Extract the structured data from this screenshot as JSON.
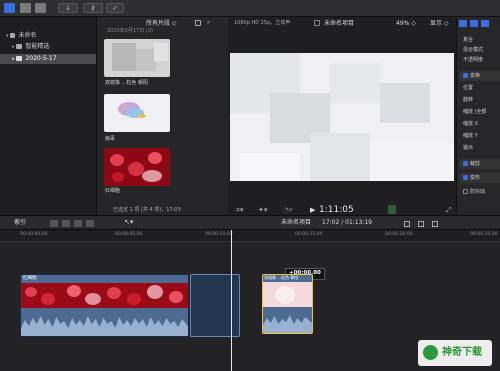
{
  "topbar": {
    "download_icon": "↓",
    "key_icon": "⚷",
    "check_icon": "✓"
  },
  "library": {
    "items": [
      {
        "label": "未命名",
        "selected": false
      },
      {
        "label": "智能精选",
        "selected": false
      },
      {
        "label": "2020-5-17",
        "selected": true
      }
    ]
  },
  "browser": {
    "filter": "所有片段",
    "date_header": "2020年5月17日",
    "date_count": "(3)",
    "clips": [
      {
        "label": "双镜像 ...粒色 朝阳"
      },
      {
        "label": "病毒"
      },
      {
        "label": "红细胞"
      }
    ],
    "status": "已选定 1 项 (共 4 项)，17:03"
  },
  "viewer": {
    "format": "1080p HD 25p，立体声",
    "project": "未命名项目",
    "zoom": "49%",
    "display": "显示",
    "timecode": "1:11:05"
  },
  "inspector": {
    "rows": [
      {
        "label": "复合",
        "checkbox": "none"
      },
      {
        "label": "混合模式",
        "checkbox": "none"
      },
      {
        "label": "不透明度",
        "checkbox": "none"
      },
      {
        "label": "变换",
        "checkbox": "on"
      },
      {
        "label": "位置",
        "checkbox": "none"
      },
      {
        "label": "旋转",
        "checkbox": "none"
      },
      {
        "label": "缩放 (全部",
        "checkbox": "none"
      },
      {
        "label": "缩放 X",
        "checkbox": "none"
      },
      {
        "label": "缩放 Y",
        "checkbox": "none"
      },
      {
        "label": "锚点",
        "checkbox": "none"
      },
      {
        "label": "裁剪",
        "checkbox": "on"
      },
      {
        "label": "变形",
        "checkbox": "on"
      },
      {
        "label": "防抖动",
        "checkbox": "off"
      }
    ]
  },
  "timeline": {
    "index_label": "索引",
    "project": "未命名项目",
    "duration": "17:02 / 01:13:19",
    "ruler": [
      "00:00:00:00",
      "00:00:05:00",
      "00:00:10:00",
      "00:00:15:00",
      "00:00:20:00",
      "00:00:25:00"
    ],
    "clip1_label": "红细胞",
    "clip2_label": "双镜像 ...粒色 朝阳",
    "tooltip": "+00:00.00"
  },
  "watermark": {
    "text": "神奇下载"
  },
  "colors": {
    "accent_blue": "#3b6dde",
    "clip_blue": "#4d6a93",
    "selection_yellow": "#e8c43a",
    "red_cells": "#c0182a"
  }
}
